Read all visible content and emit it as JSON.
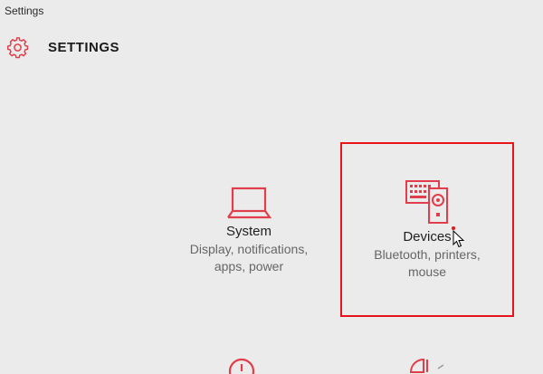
{
  "window": {
    "title": "Settings"
  },
  "header": {
    "title": "SETTINGS",
    "icon": "gear-icon"
  },
  "colors": {
    "accent": "#e13d4a",
    "highlight_border": "#e8141c",
    "background": "#ebebeb"
  },
  "tiles": [
    {
      "name": "System",
      "description_line1": "Display, notifications,",
      "description_line2": "apps, power",
      "icon": "laptop-icon"
    },
    {
      "name": "Devices",
      "description_line1": "Bluetooth, printers,",
      "description_line2": "mouse",
      "icon": "devices-icon"
    }
  ],
  "partial_tiles": [
    {
      "icon": "clock-icon"
    },
    {
      "icon": "pie-icon"
    }
  ]
}
